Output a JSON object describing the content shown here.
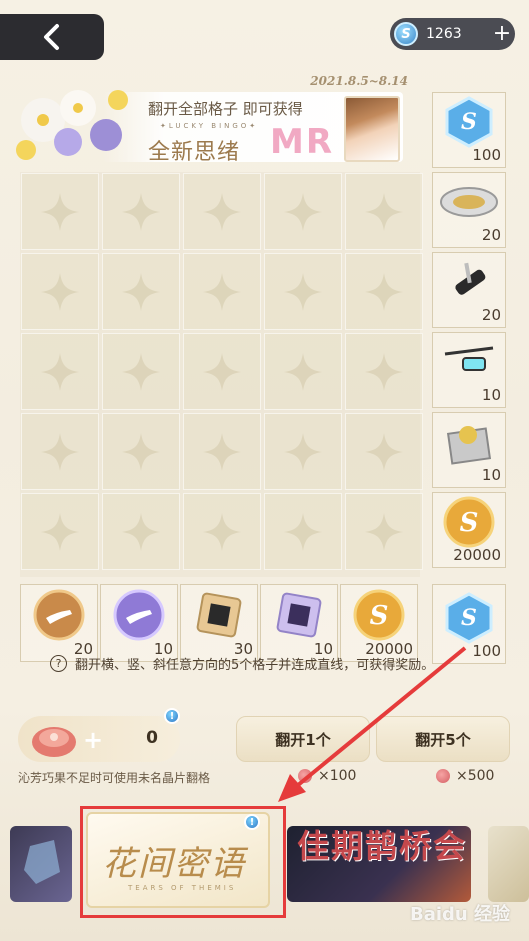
{
  "header": {
    "back_icon": "chevron-left-icon",
    "currency_icon": "crystal-s-icon",
    "currency_amount": "1263",
    "currency_plus": "+"
  },
  "banner": {
    "date_range": "2021.8.5~8.14",
    "line1": "翻开全部格子 即可获得",
    "subtitle": "✦LUCKY BINGO✦",
    "line2": "全新思绪",
    "badge": "MR"
  },
  "side_rewards": [
    {
      "icon": "crystal-s-icon",
      "count": "100"
    },
    {
      "icon": "tray-icon",
      "count": "20"
    },
    {
      "icon": "pocket-knife-icon",
      "count": "20"
    },
    {
      "icon": "glasses-icon",
      "count": "10"
    },
    {
      "icon": "photo-frame-icon",
      "count": "10"
    },
    {
      "icon": "gold-coin-icon",
      "count": "20000"
    }
  ],
  "row_rewards": [
    {
      "icon": "gold-pipe-coin-icon",
      "count": "20"
    },
    {
      "icon": "purple-pipe-coin-icon",
      "count": "10"
    },
    {
      "icon": "gold-chip-icon",
      "count": "30"
    },
    {
      "icon": "purple-chip-icon",
      "count": "10"
    },
    {
      "icon": "gold-coin-icon",
      "count": "20000"
    }
  ],
  "diagonal_reward": {
    "icon": "crystal-s-icon",
    "count": "100"
  },
  "hint": {
    "icon": "?",
    "text": "翻开横、竖、斜任意方向的5个格子并连成直线，可获得奖励。"
  },
  "controls": {
    "cookie_count": "0",
    "cookie_plus": "+",
    "cookie_hint": "沁芳巧果不足时可使用未名晶片翻格",
    "flip_one_label": "翻开1个",
    "flip_five_label": "翻开5个",
    "flip_one_cost": "×100",
    "flip_five_cost": "×500"
  },
  "events": {
    "main_title": "花间密语",
    "main_sub": "TEARS OF THEMIS",
    "right_title": "佳期鹊桥会",
    "notice": "!"
  },
  "watermark": "Baidu 经验",
  "colors": {
    "highlight": "#e53b3b",
    "accent_gold": "#b88c4c",
    "badge_pink": "#f1a9c3"
  }
}
